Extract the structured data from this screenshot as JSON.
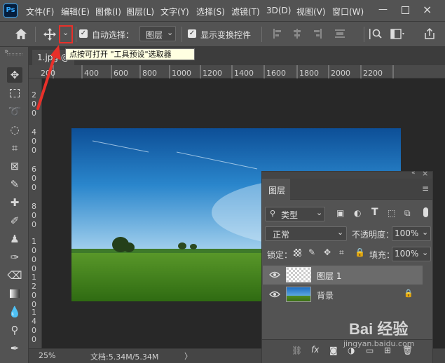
{
  "menubar": {
    "logo": "Ps",
    "items": [
      "文件(F)",
      "编辑(E)",
      "图像(I)",
      "图层(L)",
      "文字(Y)",
      "选择(S)",
      "滤镜(T)",
      "3D(D)",
      "视图(V)",
      "窗口(W)"
    ]
  },
  "options": {
    "auto_select_label": "自动选择：",
    "auto_select_value": "图层",
    "transform_label": "显示变换控件"
  },
  "tooltip": "点按可打开 \"工具预设\"选取器",
  "doc_tab": "1.jpg @",
  "ruler": {
    "h_labels": [
      "200",
      "400",
      "600",
      "800",
      "1000",
      "1200",
      "1400",
      "1600",
      "1800",
      "2000",
      "2200"
    ],
    "v_labels": [
      "200",
      "400",
      "600",
      "800",
      "1000",
      "1200",
      "1400"
    ]
  },
  "status": {
    "zoom": "25%",
    "doc_info": "文档:5.34M/5.34M",
    "arrow": "〉"
  },
  "layers": {
    "tab": "图层",
    "filter_type": "类型",
    "blend_mode": "正常",
    "opacity_label": "不透明度：",
    "opacity_value": "100%",
    "lock_label": "锁定：",
    "fill_label": "填充：",
    "fill_value": "100%",
    "items": [
      {
        "name": "图层 1"
      },
      {
        "name": "背景"
      }
    ],
    "collapse": "«",
    "close": "×"
  },
  "watermark": "Bai 经验",
  "watermark_sub": "jingyan.baidu.com",
  "colors": {
    "accent_red": "#e8302a",
    "panel": "#535353",
    "canvas": "#282828"
  }
}
